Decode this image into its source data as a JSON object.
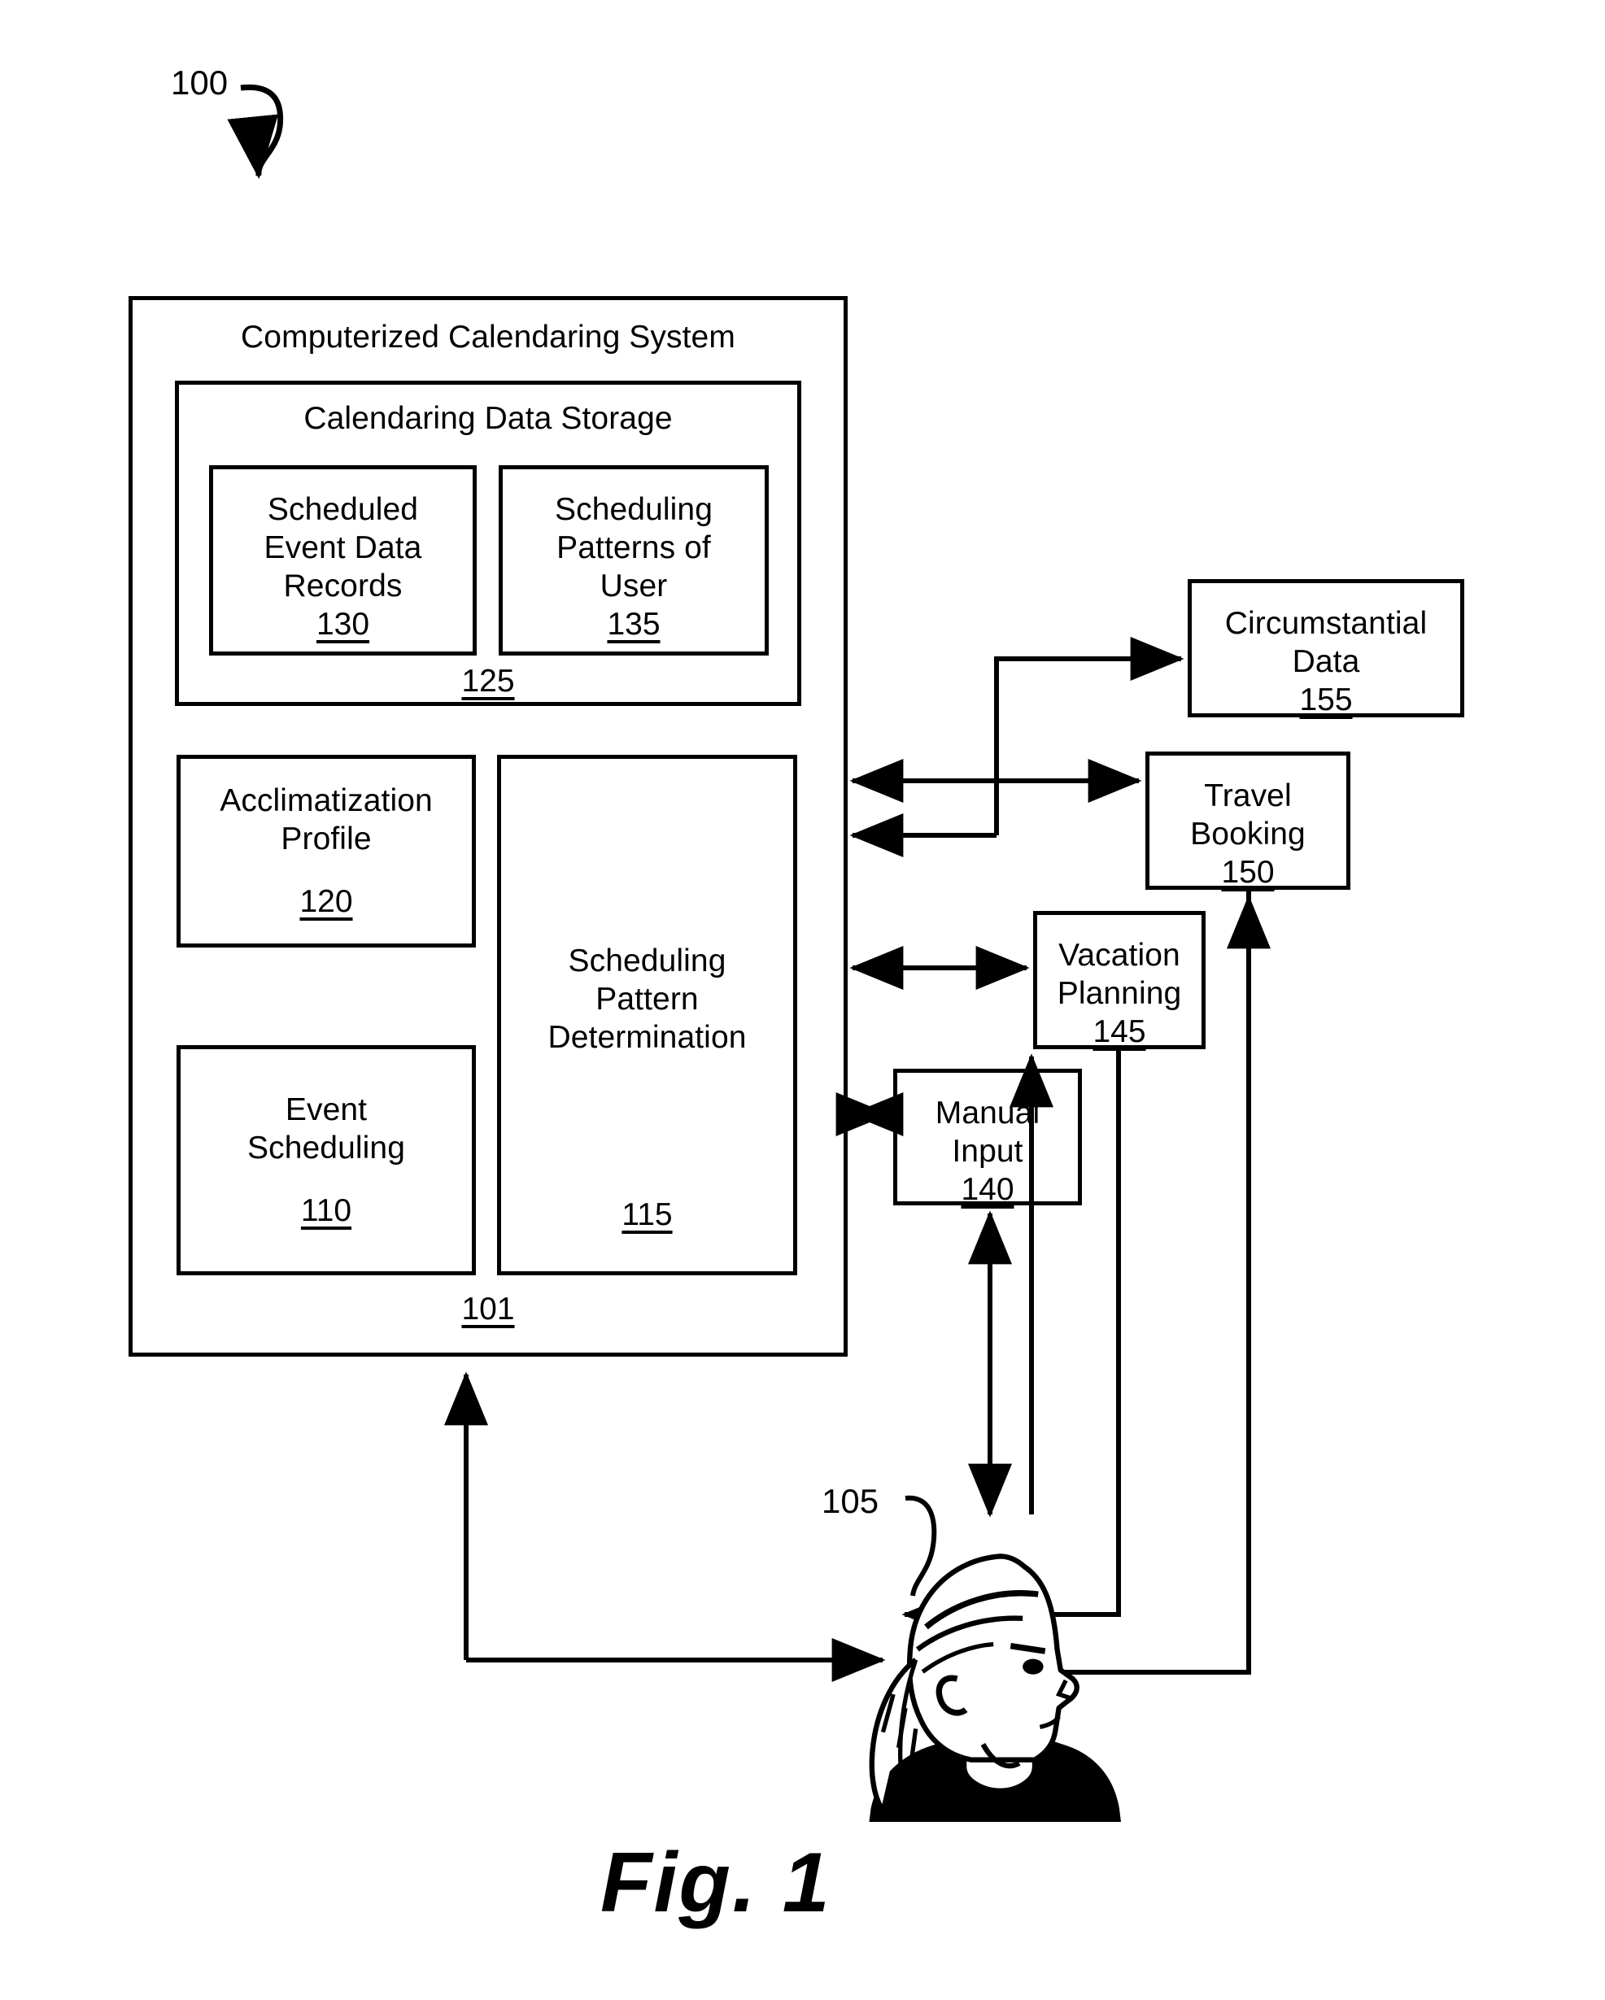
{
  "figure": {
    "caption": "Fig. 1",
    "system_reference": "100",
    "user_reference": "105"
  },
  "system": {
    "title": "Computerized Calendaring System",
    "reference": "101",
    "storage": {
      "title": "Calendaring Data Storage",
      "reference": "125",
      "components": [
        {
          "label": "Scheduled\nEvent Data\nRecords",
          "reference": "130"
        },
        {
          "label": "Scheduling\nPatterns of\nUser",
          "reference": "135"
        }
      ]
    },
    "modules": [
      {
        "label": "Acclimatization\nProfile",
        "reference": "120"
      },
      {
        "label": "Event\nScheduling",
        "reference": "110"
      },
      {
        "label": "Scheduling\nPattern\nDetermination",
        "reference": "115"
      }
    ]
  },
  "external": [
    {
      "label": "Circumstantial\nData",
      "reference": "155"
    },
    {
      "label": "Travel\nBooking",
      "reference": "150"
    },
    {
      "label": "Vacation\nPlanning",
      "reference": "145"
    },
    {
      "label": "Manual\nInput",
      "reference": "140"
    }
  ],
  "actor": {
    "name": "user-head-profile"
  }
}
